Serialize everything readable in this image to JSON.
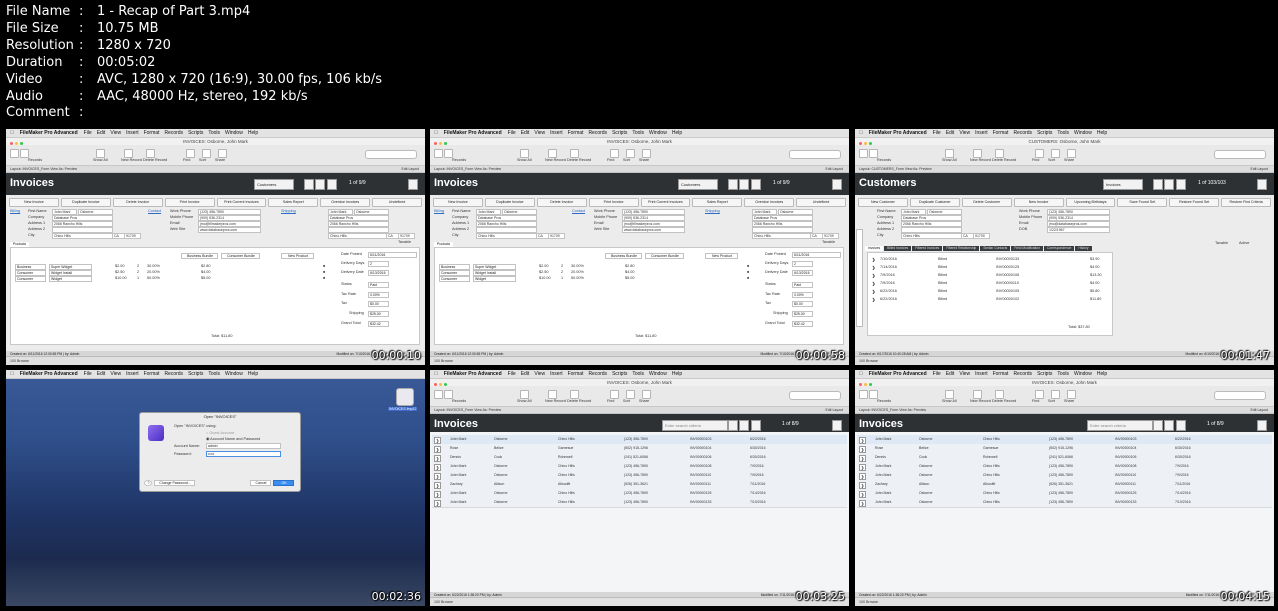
{
  "file_info": [
    {
      "key": "File Name",
      "value": "1 - Recap of Part 3.mp4"
    },
    {
      "key": "File Size",
      "value": "10.75 MB"
    },
    {
      "key": "Resolution",
      "value": "1280 x 720"
    },
    {
      "key": "Duration",
      "value": "00:05:02"
    },
    {
      "key": "Video",
      "value": "AVC, 1280 x 720 (16:9), 30.00 fps, 106 kb/s"
    },
    {
      "key": "Audio",
      "value": "AAC, 48000 Hz, stereo, 192 kb/s"
    },
    {
      "key": "Comment",
      "value": ""
    }
  ],
  "menu": {
    "app": "FileMaker Pro Advanced",
    "items": [
      "File",
      "Edit",
      "View",
      "Insert",
      "Format",
      "Records",
      "Scripts",
      "Tools",
      "Window",
      "Help"
    ]
  },
  "toolbar": {
    "records": "Records",
    "show_all": "Show All",
    "new_record": "New Record",
    "delete_record": "Delete Record",
    "find": "Find",
    "sort": "Sort",
    "share": "Share",
    "search": "Search",
    "layout_label": "Layout:",
    "layout_invoices": "INVOICES_Form",
    "layout_customers": "CUSTOMERS_Form",
    "view_as": "View As:",
    "preview": "Preview",
    "edit_layout": "Edit Layout",
    "browse": "Browse"
  },
  "thumbs": [
    {
      "timestamp": "00:00:10",
      "window_title": "INVOICES: Osborne, John Mark",
      "header_title": "Invoices",
      "nav_select": "Customers",
      "record_count": "1 of 9/9",
      "buttons": [
        "New Invoice",
        "Duplicate Invoice",
        "Delete Invoice",
        "Print Invoice",
        "Print Current Invoices",
        "Sales Report",
        "Overdue Invoices",
        "Undefined"
      ],
      "billing": "Billing",
      "contact": "Contact",
      "shipping": "Shipping",
      "first_name_label": "First Name",
      "first_name": "John Mark",
      "last_name": "Osborne",
      "company_label": "Company",
      "company": "Database Pros",
      "address1_label": "Address 1",
      "address1": "2066 Rancho Hills",
      "address2_label": "Address 2",
      "city_label": "City",
      "city": "Chino Hills",
      "state": "CA",
      "zip": "91709",
      "work_phone_label": "Work Phone",
      "work_phone": "(123) 456-7890",
      "mobile_label": "Mobile Phone",
      "mobile": "(909) 536-2314",
      "email_label": "Email",
      "email": "jmo@filmakerpros.com",
      "web_label": "Web Site",
      "web": "www.databasepros.com",
      "taxable": "Taxable",
      "products_tab": "Products",
      "bundle1": "Business Bundle",
      "bundle2": "Consumer Bundle",
      "new_product": "New Product",
      "line_items": [
        {
          "type": "Business",
          "name": "Super Widget",
          "price": "$2.00",
          "qty": "2",
          "disc": "30.00%",
          "total": "$2.80"
        },
        {
          "type": "Consumer",
          "name": "Widget Install",
          "price": "$2.50",
          "qty": "2",
          "disc": "20.00%",
          "total": "$4.00"
        },
        {
          "type": "Consumer",
          "name": "Widget",
          "price": "$10.00",
          "qty": "1",
          "disc": "50.00%",
          "total": "$5.00"
        }
      ],
      "date_posted_label": "Date Posted",
      "date_posted": "6/11/2016",
      "delivery_days_label": "Delivery Days",
      "delivery_days": "2",
      "delivery_date_label": "Delivery Date",
      "delivery_date": "6/13/2016",
      "status_label": "Status",
      "status": "Paid",
      "tax_rate_label": "Tax Rate",
      "tax_rate": "0.00%",
      "tax_label": "Tax",
      "tax": "$0.00",
      "shipping_label": "Shipping",
      "shipping_amt": "$25.00",
      "grand_label": "Grand Total",
      "grand": "$32.42",
      "total_label": "Total:",
      "total": "$11.80",
      "created": "Created on: 6/11/2016 12:00:55 PM | by: Admin",
      "modified": "Modified on: 7/10/2016"
    },
    {
      "timestamp": "00:00:58",
      "window_title": "INVOICES: Osborne, John Mark",
      "header_title": "Invoices",
      "nav_select": "Customers",
      "record_count": "1 of 9/9",
      "buttons": [
        "New Invoice",
        "Duplicate Invoice",
        "Delete Invoice",
        "Print Invoice",
        "Print Current Invoices",
        "Sales Report",
        "Overdue Invoices",
        "Undefined"
      ],
      "billing": "Billing",
      "contact": "Contact",
      "shipping": "Shipping",
      "first_name_label": "First Name",
      "first_name": "John Mark",
      "last_name": "Osborne",
      "company_label": "Company",
      "company": "Database Pros",
      "address1_label": "Address 1",
      "address1": "2066 Rancho Hills",
      "address2_label": "Address 2",
      "city_label": "City",
      "city": "Chino Hills",
      "state": "CA",
      "zip": "91709",
      "work_phone_label": "Work Phone",
      "work_phone": "(123) 456-7890",
      "mobile_label": "Mobile Phone",
      "mobile": "(909) 536-2314",
      "email_label": "Email",
      "email": "jmo@filmakerpros.com",
      "web_label": "Web Site",
      "web": "www.databasepros.com",
      "taxable": "Taxable",
      "products_tab": "Products",
      "bundle1": "Business Bundle",
      "bundle2": "Consumer Bundle",
      "new_product": "New Product",
      "line_items": [
        {
          "type": "Business",
          "name": "Super Widget",
          "price": "$2.00",
          "qty": "2",
          "disc": "30.00%",
          "total": "$2.80"
        },
        {
          "type": "Consumer",
          "name": "Widget Install",
          "price": "$2.50",
          "qty": "2",
          "disc": "20.00%",
          "total": "$4.00"
        },
        {
          "type": "Consumer",
          "name": "Widget",
          "price": "$10.00",
          "qty": "1",
          "disc": "50.00%",
          "total": "$5.00"
        }
      ],
      "date_posted_label": "Date Posted",
      "date_posted": "6/11/2016",
      "delivery_days_label": "Delivery Days",
      "delivery_days": "2",
      "delivery_date_label": "Delivery Date",
      "delivery_date": "6/13/2016",
      "status_label": "Status",
      "status": "Paid",
      "tax_rate_label": "Tax Rate",
      "tax_rate": "0.00%",
      "tax_label": "Tax",
      "tax": "$0.00",
      "shipping_label": "Shipping",
      "shipping_amt": "$25.00",
      "grand_label": "Grand Total",
      "grand": "$32.42",
      "total_label": "Total:",
      "total": "$11.80",
      "created": "Created on: 6/11/2016 12:00:55 PM | by: Admin",
      "modified": "Modified on: 7/10/2016"
    },
    {
      "timestamp": "00:01:47",
      "window_title": "CUSTOMERS: Osborne, John Mark",
      "header_title": "Customers",
      "nav_select": "Invoices",
      "record_count": "1 of 103/103",
      "buttons": [
        "New Customer",
        "Duplicate Customer",
        "Delete Customer",
        "New Invoice",
        "Upcoming Birthdays",
        "Save Found Set",
        "Restore Found Set",
        "Restore Find Criteria"
      ],
      "first_name_label": "First Name",
      "first_name": "John Mark",
      "last_name": "Osborne",
      "company_label": "Company",
      "company": "Database Pros",
      "address1_label": "Address 1",
      "address1": "2066 Rancho Hills",
      "address2_label": "Address 2",
      "city_label": "City",
      "city": "Chino Hills",
      "state": "CA",
      "zip": "91709",
      "work_phone_label": "Work Phone",
      "work_phone": "(123) 456-7890",
      "mobile_label": "Mobile Phone",
      "mobile": "(909) 536-2314",
      "email_label": "Email",
      "email": "jmo@databasepros.com",
      "dob_label": "DOB",
      "dob": "1/22/1967",
      "taxable": "Taxable",
      "active": "Active",
      "tabs": [
        "Invoices",
        "Billed Invoices",
        "Filtered Invoices",
        "Filtered Relationship",
        "Similar Contacts",
        "Field Modification",
        "Correspondence",
        "History"
      ],
      "invoices": [
        {
          "date": "7/10/2016",
          "status": "Billed",
          "num": "INV00000133",
          "amt": "$3.90"
        },
        {
          "date": "7/14/2016",
          "status": "Billed",
          "num": "INV00000125",
          "amt": "$4.00"
        },
        {
          "date": "7/9/2016",
          "status": "Billed",
          "num": "INV00000106",
          "amt": "$13.30"
        },
        {
          "date": "7/9/2016",
          "status": "Billed",
          "num": "INV00000110",
          "amt": "$4.00"
        },
        {
          "date": "6/22/2016",
          "status": "Billed",
          "num": "INV00000105",
          "amt": "$5.80"
        },
        {
          "date": "6/22/2016",
          "status": "Billed",
          "num": "INV00000102",
          "amt": "$11.80"
        }
      ],
      "total_label": "Total:",
      "total": "$37.80",
      "created": "Created on: 6/17/2016 10:40:28 AM | by: Admin",
      "modified": "Modified on: 6/19/2016"
    },
    {
      "timestamp": "00:02:36",
      "dialog_title": "Open \"INVOICES\"",
      "dialog_prompt": "Open \"INVOICES\" using:",
      "guest": "Guest Account",
      "acct_option": "Account Name and Password",
      "acct_label": "Account Name:",
      "acct_value": "admin",
      "pass_label": "Password:",
      "pass_value": "•••••",
      "change_pw": "Change Password...",
      "cancel": "Cancel",
      "ok": "OK",
      "desktop_file": "INVOICES.fmp12"
    },
    {
      "timestamp": "00:03:25",
      "window_title": "INVOICES: Osborne, John Mark",
      "header_title": "Invoices",
      "search_placeholder": "Enter search criteria",
      "record_count": "1 of 8/9",
      "found": "Found (Unsorted)",
      "rows": [
        {
          "first": "John Mark",
          "last": "Osborne",
          "city": "Chino Hills",
          "phone": "(123) 456-7890",
          "num": "INV00000103",
          "date": "6/22/2016"
        },
        {
          "first": "Rose",
          "last": "Belize",
          "city": "Garnesue",
          "phone": "(502) 915-1296",
          "num": "INV00000104",
          "date": "6/30/2016"
        },
        {
          "first": "Dennis",
          "last": "Cook",
          "city": "Rohnwell",
          "phone": "(241) 521-6066",
          "num": "INV00000106",
          "date": "6/30/2016"
        },
        {
          "first": "John Mark",
          "last": "Osborne",
          "city": "Chino Hills",
          "phone": "(123) 456-7890",
          "num": "INV00000108",
          "date": "7/9/2016"
        },
        {
          "first": "John Mark",
          "last": "Osborne",
          "city": "Chino Hills",
          "phone": "(123) 456-7890",
          "num": "INV00000110",
          "date": "7/9/2016"
        },
        {
          "first": "Zachary",
          "last": "Allison",
          "city": "Alhusifit",
          "phone": "(526) 351-3621",
          "num": "INV00000111",
          "date": "7/11/2016"
        },
        {
          "first": "John Mark",
          "last": "Osborne",
          "city": "Chino Hills",
          "phone": "(123) 456-7890",
          "num": "INV00000125",
          "date": "7/14/2016"
        },
        {
          "first": "John Mark",
          "last": "Osborne",
          "city": "Chino Hills",
          "phone": "(123) 456-7890",
          "num": "INV00000133",
          "date": "7/10/2016"
        }
      ],
      "created": "Created on: 6/22/2016 1:38:20 PM | by: Admin",
      "modified": "Modified on: 7/11/2016"
    },
    {
      "timestamp": "00:04:15",
      "window_title": "INVOICES: Osborne, John Mark",
      "header_title": "Invoices",
      "search_placeholder": "Enter search criteria",
      "record_count": "1 of 8/9",
      "found": "Found (Unsorted)",
      "rows": [
        {
          "first": "John Mark",
          "last": "Osborne",
          "city": "Chino Hills",
          "phone": "(123) 456-7890",
          "num": "INV00000103",
          "date": "6/22/2016"
        },
        {
          "first": "Rose",
          "last": "Belize",
          "city": "Garnesue",
          "phone": "(502) 915-1296",
          "num": "INV00000104",
          "date": "6/30/2016"
        },
        {
          "first": "Dennis",
          "last": "Cook",
          "city": "Rohnwell",
          "phone": "(241) 521-6066",
          "num": "INV00000106",
          "date": "6/30/2016"
        },
        {
          "first": "John Mark",
          "last": "Osborne",
          "city": "Chino Hills",
          "phone": "(123) 456-7890",
          "num": "INV00000108",
          "date": "7/9/2016"
        },
        {
          "first": "John Mark",
          "last": "Osborne",
          "city": "Chino Hills",
          "phone": "(123) 456-7890",
          "num": "INV00000110",
          "date": "7/9/2016"
        },
        {
          "first": "Zachary",
          "last": "Allison",
          "city": "Alhusifit",
          "phone": "(526) 351-3621",
          "num": "INV00000111",
          "date": "7/11/2016"
        },
        {
          "first": "John Mark",
          "last": "Osborne",
          "city": "Chino Hills",
          "phone": "(123) 456-7890",
          "num": "INV00000125",
          "date": "7/14/2016"
        },
        {
          "first": "John Mark",
          "last": "Osborne",
          "city": "Chino Hills",
          "phone": "(123) 456-7890",
          "num": "INV00000133",
          "date": "7/10/2016"
        }
      ],
      "created": "Created on: 6/22/2016 1:38:20 PM | by: Admin",
      "modified": "Modified on: 7/11/2016"
    }
  ]
}
